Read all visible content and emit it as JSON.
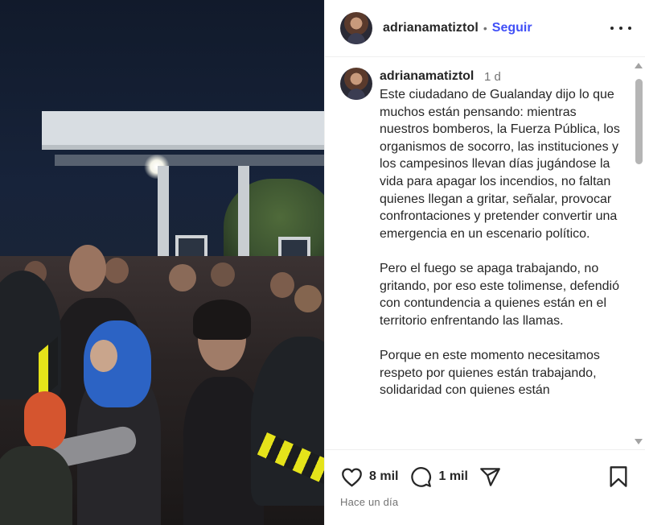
{
  "post": {
    "author": "adrianamatiztol",
    "separator": "•",
    "follow_label": "Seguir"
  },
  "caption": {
    "author": "adrianamatiztol",
    "age": "1 d",
    "paragraphs": [
      "Este ciudadano de Gualanday dijo lo que muchos están pensando: mientras nuestros bomberos, la Fuerza Pública, los organismos de socorro, las instituciones y los campesinos llevan días jugándose la vida para apagar los incendios, no faltan quienes llegan a gritar, señalar, provocar confrontaciones y pretender convertir una emergencia en un escenario político.",
      "Pero el fuego se apaga trabajando, no gritando, por eso este tolimense, defendió con contundencia a quienes están en el territorio enfrentando las llamas.",
      "Porque en este momento necesitamos respeto por quienes están trabajando, solidaridad con quienes están"
    ]
  },
  "actions": {
    "likes": "8 mil",
    "comments": "1 mil",
    "timestamp": "Hace un día"
  },
  "icons": {
    "more": "more-options-icon",
    "like": "heart-icon",
    "comment": "comment-icon",
    "share": "paper-plane-icon",
    "save": "bookmark-icon"
  },
  "colors": {
    "follow": "#4150f7",
    "text": "#262626",
    "muted": "#737373"
  }
}
